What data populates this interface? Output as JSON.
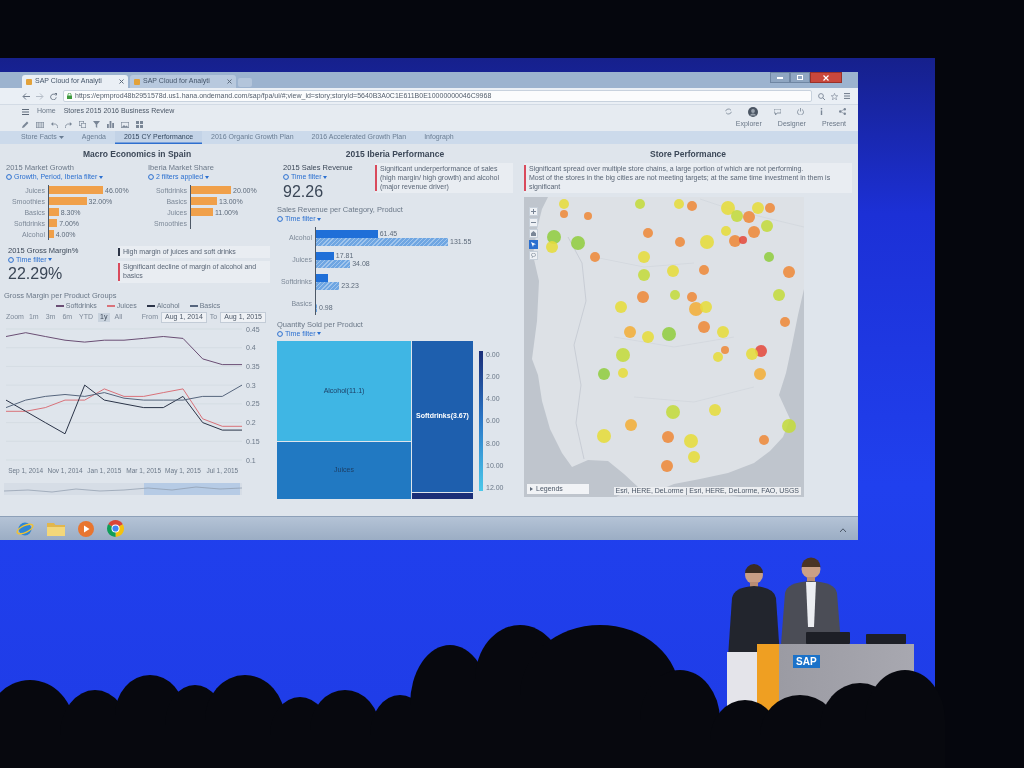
{
  "browser": {
    "tabs": [
      {
        "title": "SAP Cloud for Analyti",
        "selected": true
      },
      {
        "title": "SAP Cloud for Analyti",
        "selected": false
      }
    ],
    "url": "https://epmprod48b2951578d.us1.hana.ondemand.com/sap/fpa/ui/#;view_id=story;storyId=5640B3A0C1E611B0E10000000046C9968"
  },
  "app_header": {
    "home": "Home",
    "story_title": "Stores 2015 2016 Business Review",
    "modes": [
      "Explorer",
      "Designer",
      "Present"
    ]
  },
  "page_tabs": [
    {
      "label": "Store Facts",
      "kind": "menu",
      "selected": false
    },
    {
      "label": "Agenda",
      "kind": "page",
      "selected": false
    },
    {
      "label": "2015 CY Performance",
      "kind": "page",
      "selected": true
    },
    {
      "label": "2016 Organic Growth Plan",
      "kind": "page",
      "selected": false
    },
    {
      "label": "2016 Accelerated Growth Plan",
      "kind": "page",
      "selected": false
    },
    {
      "label": "Infograph",
      "kind": "page",
      "selected": false
    }
  ],
  "macro": {
    "title": "Macro Economics in Spain",
    "bar_charts": [
      {
        "title": "2015 Market Growth",
        "filter": "Growth, Period, Iberia filter",
        "chart_data": {
          "type": "bar",
          "orientation": "horizontal",
          "categories": [
            "Juices",
            "Smoothies",
            "Basics",
            "Softdrinks",
            "Alcohol"
          ],
          "values": [
            46,
            32,
            8.3,
            7,
            4
          ],
          "value_labels": [
            "46.00%",
            "32.00%",
            "8.30%",
            "7.00%",
            "4.00%"
          ]
        }
      },
      {
        "title": "Iberia Market Share",
        "filter": "2 filters applied",
        "chart_data": {
          "type": "bar",
          "orientation": "horizontal",
          "categories": [
            "Softdrinks",
            "Basics",
            "Juices",
            "Smoothies"
          ],
          "values": [
            20,
            13,
            11,
            null
          ],
          "value_labels": [
            "20.00%",
            "13.00%",
            "11.00%",
            null
          ]
        }
      }
    ],
    "kpi": {
      "title": "2015 Gross Margin%",
      "filter": "Time filter",
      "value": "22.29%"
    },
    "notes": [
      {
        "text": "High margin of juices and soft drinks",
        "color": "#2c3446"
      },
      {
        "text": "Significant decline of margin of alcohol and basics",
        "color": "#d94a5c"
      }
    ],
    "line_chart": {
      "title": "Gross Margin per Product Groups",
      "zoom_label": "Zoom",
      "zoom_buttons": [
        {
          "label": "1m",
          "selected": false
        },
        {
          "label": "3m",
          "selected": false
        },
        {
          "label": "6m",
          "selected": false
        },
        {
          "label": "YTD",
          "selected": false
        },
        {
          "label": "1y",
          "selected": true
        },
        {
          "label": "All",
          "selected": false
        }
      ],
      "from_label": "From",
      "from": "Aug 1, 2014",
      "to_label": "To",
      "to": "Aug 1, 2015",
      "chart_data": {
        "type": "line",
        "categories": [
          null,
          "Sep 1, 2014",
          null,
          "Nov 1, 2014",
          null,
          "Jan 1, 2015",
          null,
          "Mar 1, 2015",
          null,
          "May 1, 2015",
          null,
          "Jul 1, 2015",
          null
        ],
        "ylim": [
          0.1,
          0.45
        ],
        "yticks": [
          0.1,
          0.15,
          0.2,
          0.25,
          0.3,
          0.35,
          0.4,
          0.45
        ],
        "grid": true,
        "legend": "top",
        "series": [
          {
            "name": "Softdrinks",
            "color": "#6a4e74",
            "values": [
              0.43,
              0.44,
              0.43,
              0.42,
              0.415,
              0.42,
              0.42,
              0.425,
              0.43,
              0.425,
              0.37,
              0.355,
              0.355
            ]
          },
          {
            "name": "Juices",
            "color": "#d9727a",
            "values": [
              0.23,
              0.23,
              0.24,
              0.26,
              0.26,
              0.29,
              0.27,
              0.27,
              0.28,
              0.29,
              0.21,
              0.19,
              0.19
            ]
          },
          {
            "name": "Alcohol",
            "color": "#2b3448",
            "values": [
              0.26,
              0.23,
              0.2,
              0.17,
              0.3,
              0.26,
              0.25,
              0.24,
              0.24,
              0.27,
              0.2,
              0.18,
              0.18
            ]
          },
          {
            "name": "Basics",
            "color": "#56657d",
            "values": [
              0.24,
              0.26,
              0.27,
              0.275,
              0.27,
              0.28,
              0.265,
              0.26,
              0.26,
              0.26,
              0.27,
              0.27,
              0.3
            ]
          }
        ]
      }
    }
  },
  "iberia": {
    "title": "2015 Iberia Performance",
    "kpi": {
      "title": "2015 Sales Revenue",
      "filter": "Time filter",
      "value": "92.26"
    },
    "note": {
      "text": "Significant underperformance of sales (high margin/ high growth) and alcohol (major revenue driver)",
      "color": "#d94a5c"
    },
    "revenue_chart": {
      "title": "Sales Revenue per Category, Product",
      "filter": "Time filter",
      "chart_data": {
        "type": "bar",
        "orientation": "horizontal",
        "categories": [
          "Alcohol",
          "Juices",
          "Softdrinks",
          "Basics"
        ],
        "series": [
          {
            "color": "#1f6fd8",
            "values": [
              61.45,
              17.81,
              11.6,
              null
            ],
            "value_labels": [
              "61.45",
              "17.81",
              null,
              null
            ]
          },
          {
            "color": "#6fa6e2",
            "values": [
              131.55,
              34.08,
              23.23,
              0.98
            ],
            "value_labels": [
              "131.55",
              "34.08",
              "23.23",
              "0.98"
            ]
          }
        ]
      }
    },
    "treemap": {
      "title": "Quantity Sold per Product",
      "filter": "Time filter",
      "tiles": [
        {
          "label": "Alcohol(11.1)",
          "color": "#3fb6e4"
        },
        {
          "label": "Juices",
          "color": "#2179c2"
        },
        {
          "label": "Softdrinks(3.67)",
          "color": "#1e5fae"
        },
        {
          "color": "#1b2e78"
        }
      ],
      "scale_ticks": [
        "0.00",
        "2.00",
        "4.00",
        "6.00",
        "8.00",
        "10.00",
        "12.00"
      ]
    }
  },
  "stores": {
    "title": "Store Performance",
    "note": {
      "lines": [
        "Significant spread over multiple store chains, a large portion of which are not performing.",
        "Most of the stores in the big cities are not meeting targets; at the same time investment in them is significant"
      ],
      "color": "#d94a5c"
    },
    "map": {
      "tools": [
        {
          "kind": "zoom-in",
          "selected": false
        },
        {
          "kind": "zoom-out",
          "selected": false
        },
        {
          "kind": "home",
          "selected": false
        },
        {
          "kind": "select",
          "selected": true
        },
        {
          "kind": "lasso",
          "selected": false
        }
      ],
      "legend_button": "Legends",
      "attribution": "Esri, HERE, DeLorme | Esri, HERE, DeLorme, FAO, USGS"
    }
  },
  "stage": {
    "podium_logo": "SAP"
  }
}
